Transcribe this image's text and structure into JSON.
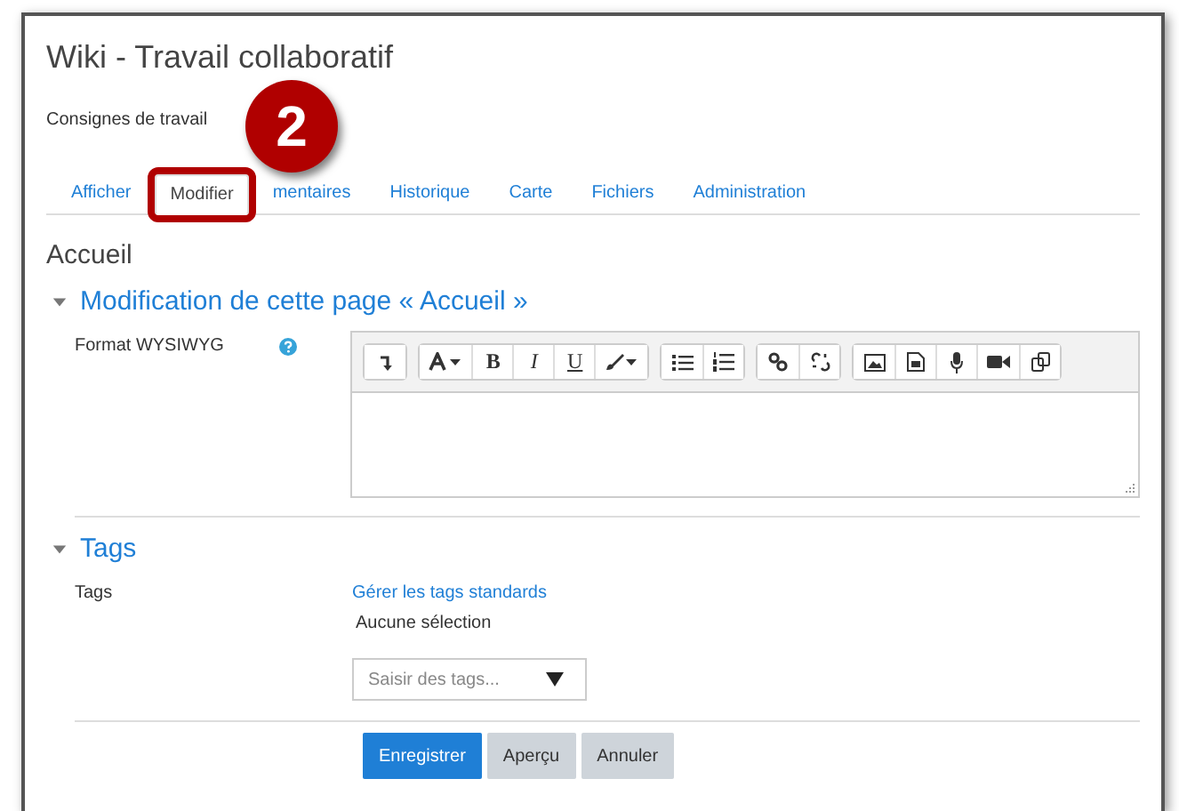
{
  "window": {
    "title": "Wiki - Travail collaboratif"
  },
  "subtitle": "Consignes de travail",
  "tabs": [
    {
      "label": "Afficher",
      "selected": false,
      "highlighted": false
    },
    {
      "label": "Modifier",
      "selected": true,
      "highlighted": true
    },
    {
      "label": "mentaires",
      "selected": false,
      "highlighted": false
    },
    {
      "label": "Historique",
      "selected": false,
      "highlighted": false
    },
    {
      "label": "Carte",
      "selected": false,
      "highlighted": false
    },
    {
      "label": "Fichiers",
      "selected": false,
      "highlighted": false
    },
    {
      "label": "Administration",
      "selected": false,
      "highlighted": false
    }
  ],
  "callout": {
    "number": "2"
  },
  "page_title": "Accueil",
  "edit_section": {
    "heading": "Modification de cette page « Accueil »",
    "expanded": true,
    "field_label": "Format WYSIWYG",
    "toolbar": [
      [
        {
          "kind": "indent"
        }
      ],
      [
        {
          "kind": "font"
        },
        {
          "kind": "bold",
          "label": "B"
        },
        {
          "kind": "italic",
          "label": "I"
        },
        {
          "kind": "underline",
          "label": "U"
        },
        {
          "kind": "brush"
        }
      ],
      [
        {
          "kind": "bullets"
        },
        {
          "kind": "numbers"
        }
      ],
      [
        {
          "kind": "link"
        },
        {
          "kind": "unlink"
        }
      ],
      [
        {
          "kind": "image"
        },
        {
          "kind": "media"
        },
        {
          "kind": "mic"
        },
        {
          "kind": "video"
        },
        {
          "kind": "copy"
        }
      ]
    ]
  },
  "tags_section": {
    "heading": "Tags",
    "expanded": true,
    "field_label": "Tags",
    "link": "Gérer les tags standards",
    "selection": "Aucune sélection",
    "placeholder": "Saisir des tags..."
  },
  "buttons": [
    {
      "label": "Enregistrer",
      "kind": "primary"
    },
    {
      "label": "Aperçu",
      "kind": "secondary"
    },
    {
      "label": "Annuler",
      "kind": "secondary"
    }
  ]
}
